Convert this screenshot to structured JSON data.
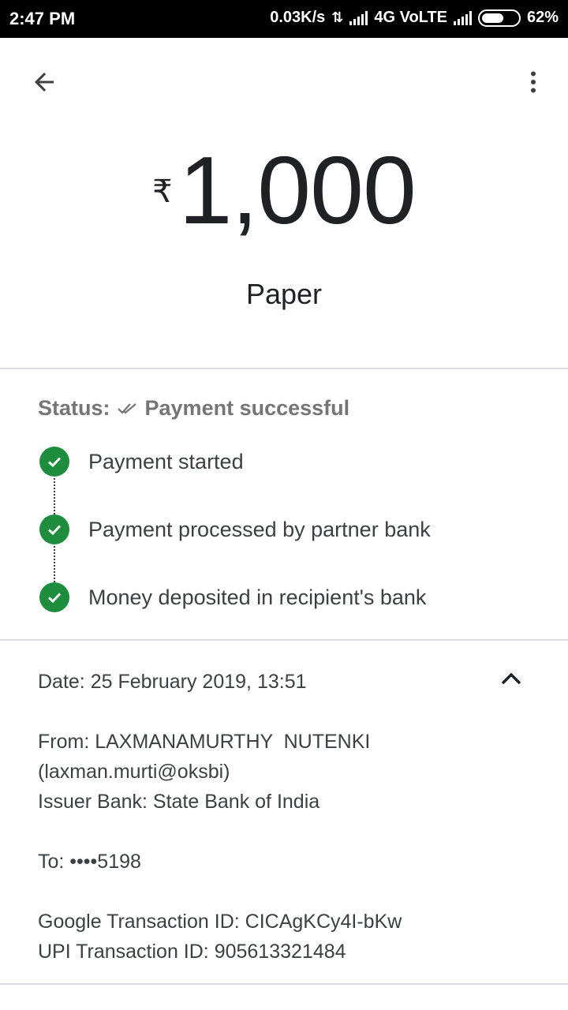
{
  "status_bar": {
    "time": "2:47 PM",
    "speed": "0.03K/s",
    "network": "4G VoLTE",
    "battery": "62%",
    "battery_level": 0.62
  },
  "appbar": {
    "back_icon": "arrow-back-icon",
    "more_icon": "more-vert-icon"
  },
  "payment": {
    "currency": "₹",
    "amount": "1,000",
    "note": "Paper"
  },
  "status": {
    "label": "Status:",
    "value": "Payment successful",
    "icon": "double-check-icon"
  },
  "steps": [
    {
      "label": "Payment started"
    },
    {
      "label": "Payment processed by partner bank"
    },
    {
      "label": "Money deposited in recipient's bank"
    }
  ],
  "details": {
    "date": "Date: 25 February 2019, 13:51",
    "from": "From: LAXMANAMURTHY  NUTENKI",
    "from_upi": "(laxman.murti@oksbi)",
    "issuer": "Issuer Bank: State Bank of India",
    "to": "To: ••••5198",
    "google_txn": "Google Transaction ID: CICAgKCy4I-bKw",
    "upi_txn": "UPI Transaction ID: 905613321484"
  },
  "colors": {
    "success_green": "#1e8e3e",
    "status_grey": "#757575"
  }
}
